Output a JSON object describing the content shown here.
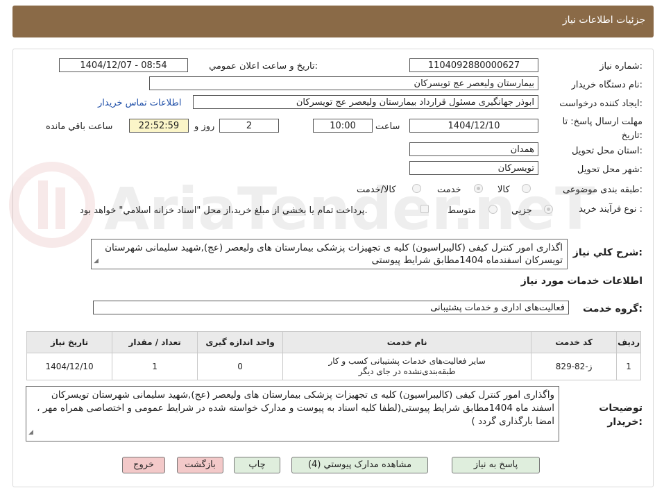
{
  "header": {
    "title": "جزئیات اطلاعات نیاز"
  },
  "fields": {
    "need_number": {
      "label": "شماره نیاز:",
      "value": "1104092880000627"
    },
    "announce_datetime": {
      "label": "تاریخ و ساعت اعلان عمومي:",
      "value": "1404/12/07 - 08:54"
    },
    "buyer_org": {
      "label": "نام دستگاه خريدار:",
      "value": "بیمارستان ولیعصر  عج  تویسرکان"
    },
    "requester": {
      "label": "ايجاد كننده درخواست:",
      "value": "ابوذر جهانگیری مسئول قرارداد بیمارستان ولیعصر  عج  تویسرکان"
    },
    "contact_link": "اطلاعات تماس خريدار",
    "deadline": {
      "label": "مهلت ارسال پاسخ: تا تاريخ:",
      "date": "1404/12/10",
      "time_label": "ساعت",
      "time": "10:00",
      "days": "2",
      "days_label": "روز و",
      "remaining": "22:52:59",
      "remaining_label": "ساعت باقي مانده"
    },
    "province": {
      "label": "استان محل تحويل:",
      "value": "همدان"
    },
    "city": {
      "label": "شهر محل تحويل:",
      "value": "تویسرکان"
    },
    "category": {
      "label": "طبقه بندی موضوعی:",
      "options": [
        "كالا",
        "خدمت",
        "كالا/خدمت"
      ],
      "selected": "خدمت"
    },
    "purchase_type": {
      "label": "نوع فرآيند خريد :",
      "options": [
        "جزيي",
        "متوسط"
      ],
      "selected": "جزيي",
      "payment_note": "پرداخت تمام يا بخشي از مبلغ خريد،از محل \"اسناد خزانه اسلامي\" خواهد بود."
    }
  },
  "summary": {
    "label": "شرح کلي نياز:",
    "text": "اگذاری امور کنترل کیفی (کالیبراسیون) کلیه ی تجهیزات پزشکی بیمارستان های ولیعصر (عج),شهید سلیمانی شهرستان تویسرکان اسفندماه 1404مطابق شرایط پیوستی"
  },
  "services_section": {
    "title": "اطلاعات خدمات مورد نياز"
  },
  "service_group": {
    "label": "گروه خدمت:",
    "value": "فعالیت‌های اداری و خدمات پشتیبانی"
  },
  "table": {
    "headers": [
      "رديف",
      "كد خدمت",
      "نام خدمت",
      "واحد اندازه گيری",
      "تعداد / مقدار",
      "تاريخ نياز"
    ],
    "rows": [
      {
        "index": "1",
        "code": "ز-82-829",
        "name": "سایر فعالیت‌های خدمات پشتیبانی کسب و کار طبقه‌بندی‌نشده در جای دیگر",
        "unit": "0",
        "qty": "1",
        "date": "1404/12/10"
      }
    ]
  },
  "buyer_notes": {
    "label": "توضيحات خريدار:",
    "text": "واگذاری امور کنترل کیفی (کالیبراسیون) کلیه ی تجهیزات پزشکی بیمارستان های ولیعصر (عج),شهید سلیمانی شهرستان تویسرکان اسفند ماه 1404مطابق شرایط پیوستی(لطفا کلیه اسناد به پیوست و مدارک خواسته شده در شرایط عمومی و اختصاصی همراه مهر ، امضا بارگذاری گردد )"
  },
  "buttons": {
    "reply": "پاسخ به نياز",
    "attachments": "مشاهده مدارک پيوستي (4)",
    "print": "چاپ",
    "back": "بازگشت",
    "exit": "خروج"
  },
  "watermark": {
    "text": "AriaTender.neT"
  },
  "colors": {
    "header": "#8a6a47",
    "button_green": "#dfeedd",
    "button_pink": "#f3c9c9",
    "timer_bg": "#fbf5c8"
  }
}
